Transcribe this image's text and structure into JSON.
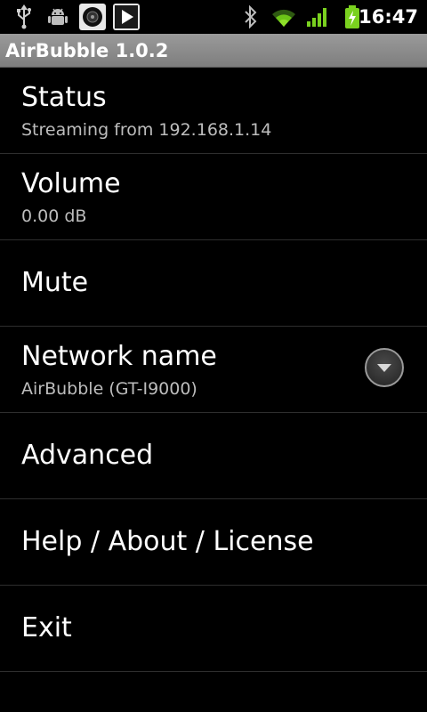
{
  "status_bar": {
    "icons": [
      "usb-icon",
      "android-debug-icon",
      "speaker-icon",
      "play-icon",
      "bluetooth-icon",
      "wifi-icon",
      "signal-icon",
      "battery-charging-icon"
    ],
    "time": "16:47"
  },
  "app": {
    "title": "AirBubble 1.0.2"
  },
  "preferences": {
    "status": {
      "title": "Status",
      "summary": "Streaming from 192.168.1.14"
    },
    "volume": {
      "title": "Volume",
      "summary": "0.00 dB"
    },
    "mute": {
      "title": "Mute"
    },
    "network_name": {
      "title": "Network name",
      "summary": "AirBubble (GT-I9000)"
    },
    "advanced": {
      "title": "Advanced"
    },
    "help": {
      "title": "Help / About / License"
    },
    "exit": {
      "title": "Exit"
    }
  }
}
